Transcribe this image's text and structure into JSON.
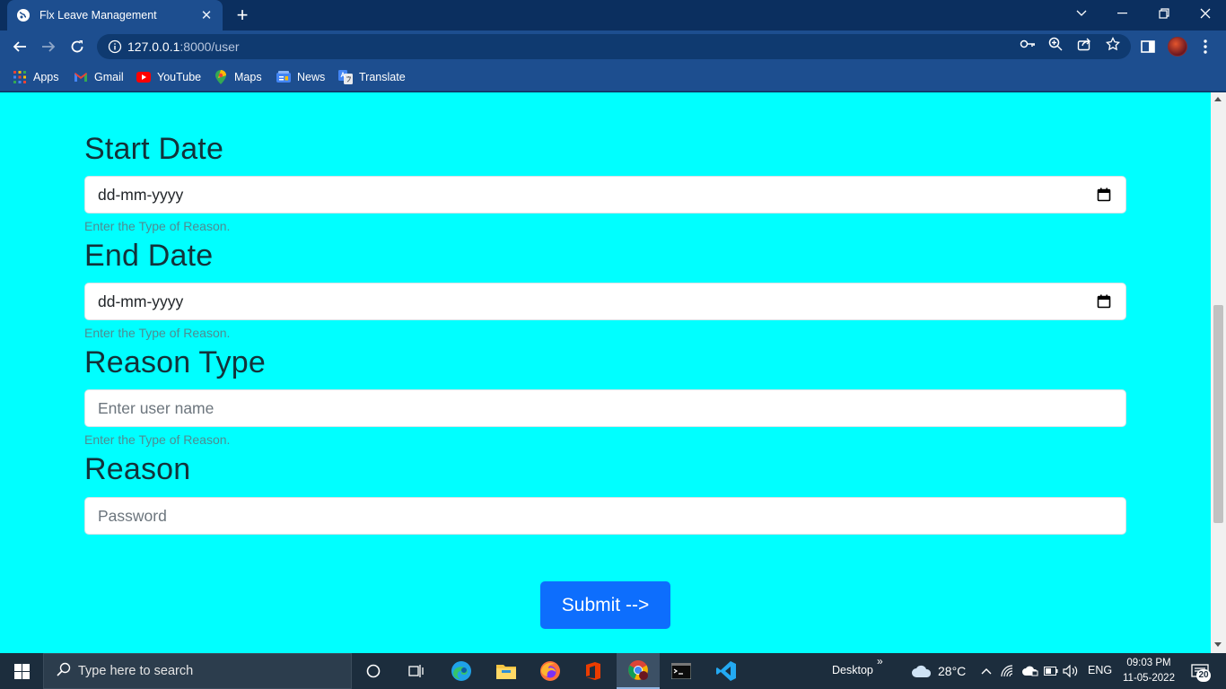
{
  "browser": {
    "tab_title": "Flx Leave Management",
    "url_host": "127.0.0.1",
    "url_path": ":8000/user",
    "bookmarks": [
      {
        "label": "Apps",
        "icon": "apps-grid-icon"
      },
      {
        "label": "Gmail",
        "icon": "gmail-icon"
      },
      {
        "label": "YouTube",
        "icon": "youtube-icon"
      },
      {
        "label": "Maps",
        "icon": "maps-icon"
      },
      {
        "label": "News",
        "icon": "news-icon"
      },
      {
        "label": "Translate",
        "icon": "translate-icon"
      }
    ]
  },
  "form": {
    "start_date": {
      "label": "Start Date",
      "value": "dd-mm-yyyy",
      "help": "Enter the Type of Reason."
    },
    "end_date": {
      "label": "End Date",
      "value": "dd-mm-yyyy",
      "help": "Enter the Type of Reason."
    },
    "reason_type": {
      "label": "Reason Type",
      "placeholder": "Enter user name",
      "help": "Enter the Type of Reason."
    },
    "reason": {
      "label": "Reason",
      "placeholder": "Password"
    },
    "submit_label": "Submit -->"
  },
  "colors": {
    "page_bg": "#00ffff",
    "submit_bg": "#0d6efd",
    "chrome_bg": "#1d4e8f"
  },
  "taskbar": {
    "search_placeholder": "Type here to search",
    "desktop_label": "Desktop",
    "weather": "28°C",
    "language": "ENG",
    "time": "09:03 PM",
    "date": "11-05-2022",
    "notification_count": "20"
  }
}
